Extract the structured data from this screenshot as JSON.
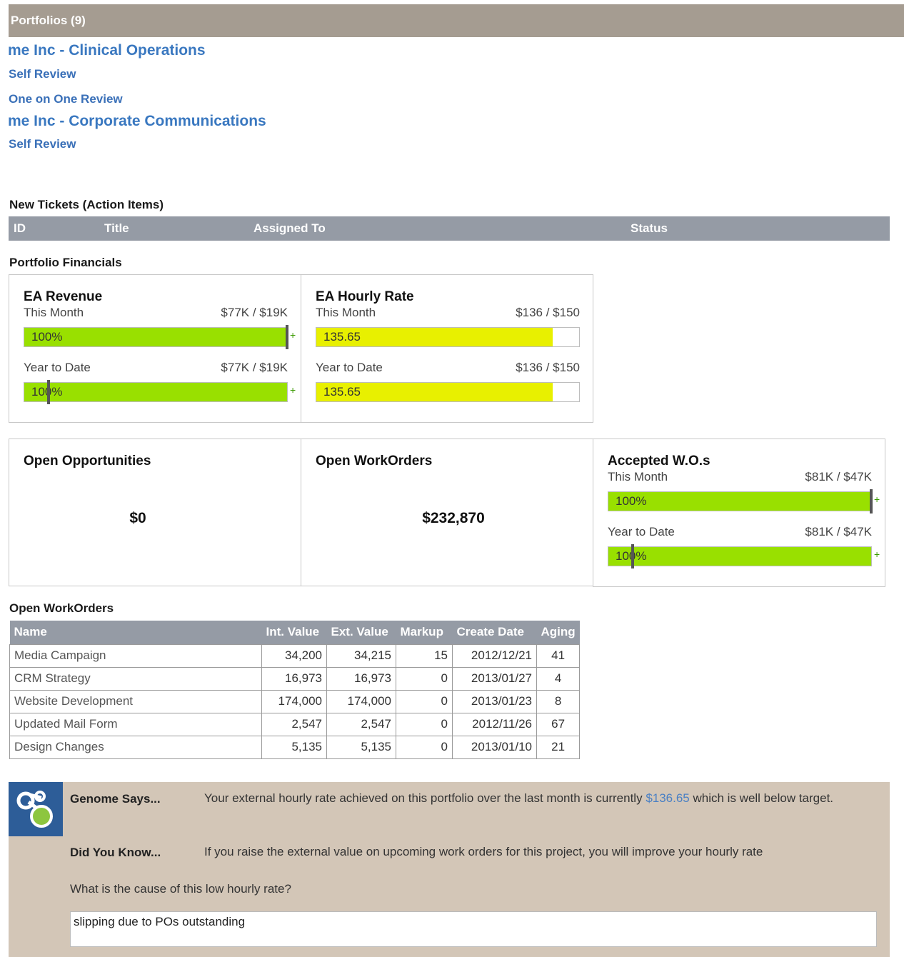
{
  "portfolios_header": "Portfolios (9)",
  "portfolios": [
    {
      "title": "me Inc - Clinical Operations",
      "links": [
        "Self Review",
        "One on One Review"
      ]
    },
    {
      "title": "me Inc - Corporate Communications",
      "links": [
        "Self Review"
      ]
    }
  ],
  "tickets": {
    "label": "New Tickets (Action Items)",
    "columns": [
      "ID",
      "Title",
      "Assigned To",
      "Status"
    ]
  },
  "financials": {
    "label": "Portfolio Financials",
    "ea_revenue": {
      "title": "EA Revenue",
      "this_month": {
        "label": "This Month",
        "value": "$77K / $19K",
        "bar_text": "100%",
        "fill_pct": 100
      },
      "ytd": {
        "label": "Year to Date",
        "value": "$77K / $19K",
        "bar_text": "100%",
        "fill_pct": 100
      }
    },
    "ea_hourly_rate": {
      "title": "EA Hourly Rate",
      "this_month": {
        "label": "This Month",
        "value": "$136 / $150",
        "bar_text": "135.65",
        "fill_pct": 90
      },
      "ytd": {
        "label": "Year to Date",
        "value": "$136 / $150",
        "bar_text": "135.65",
        "fill_pct": 90
      }
    },
    "open_opportunities": {
      "title": "Open Opportunities",
      "value": "$0"
    },
    "open_workorders": {
      "title": "Open WorkOrders",
      "value": "$232,870"
    },
    "accepted_wos": {
      "title": "Accepted W.O.s",
      "this_month": {
        "label": "This Month",
        "value": "$81K / $47K",
        "bar_text": "100%",
        "fill_pct": 100
      },
      "ytd": {
        "label": "Year to Date",
        "value": "$81K / $47K",
        "bar_text": "100%",
        "fill_pct": 100
      }
    },
    "colors": {
      "green": "#99e000",
      "yellow": "#e8f000"
    }
  },
  "workorders": {
    "label": "Open WorkOrders",
    "columns": [
      "Name",
      "Int. Value",
      "Ext. Value",
      "Markup",
      "Create Date",
      "Aging"
    ],
    "rows": [
      [
        "Media Campaign",
        "34,200",
        "34,215",
        "15",
        "2012/12/21",
        "41"
      ],
      [
        "CRM Strategy",
        "16,973",
        "16,973",
        "0",
        "2013/01/27",
        "4"
      ],
      [
        "Website Development",
        "174,000",
        "174,000",
        "0",
        "2013/01/23",
        "8"
      ],
      [
        "Updated Mail Form",
        "2,547",
        "2,547",
        "0",
        "2012/11/26",
        "67"
      ],
      [
        "Design Changes",
        "5,135",
        "5,135",
        "0",
        "2013/01/10",
        "21"
      ]
    ]
  },
  "genome": {
    "logo_icon": "genome-logo-icon",
    "says_label": "Genome Says...",
    "says_text_before": "Your external hourly rate achieved on this portfolio over the last month is currently ",
    "says_highlight": "$136.65",
    "says_text_after": " which is well below target.",
    "know_label": "Did You Know...",
    "know_text": "If you raise the external value on upcoming work orders for this project, you will improve your hourly rate",
    "question": "What is the cause of this low hourly rate?",
    "answer": "slipping due to POs outstanding"
  }
}
